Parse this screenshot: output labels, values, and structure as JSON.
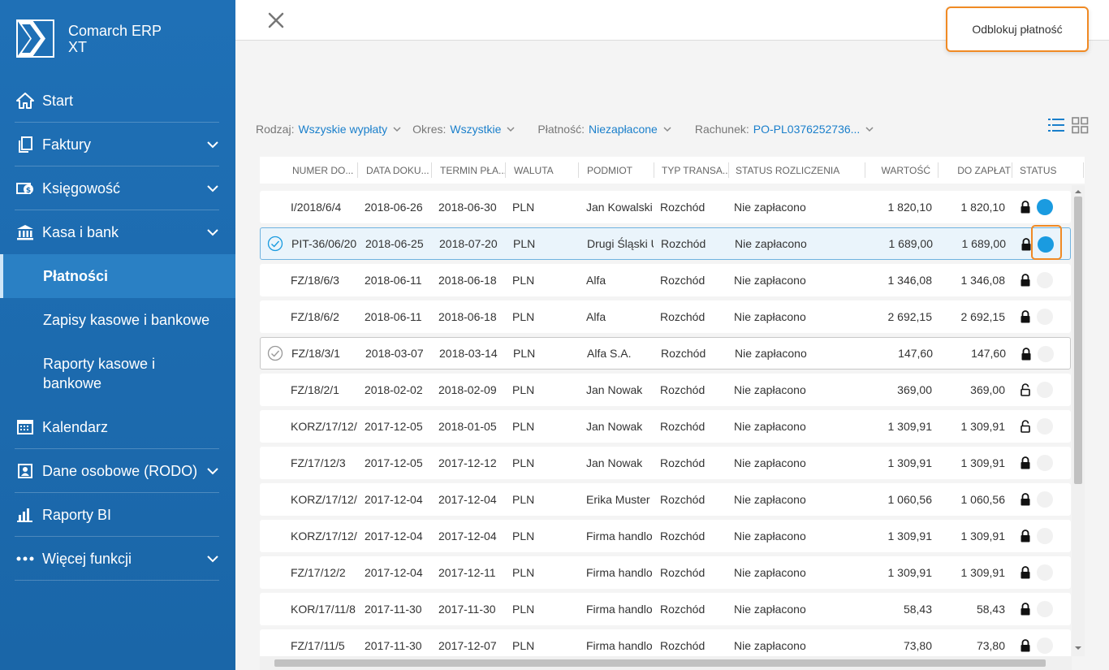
{
  "brand": {
    "line1": "Comarch ERP",
    "line2": "XT"
  },
  "nav": {
    "start": "Start",
    "faktury": "Faktury",
    "ksiegowosc": "Księgowość",
    "kasa": "Kasa i bank",
    "platnosci": "Płatności",
    "zapisy": "Zapisy kasowe i bankowe",
    "raporty_kasowe_1": "Raporty kasowe i",
    "raporty_kasowe_2": "bankowe",
    "kalendarz": "Kalendarz",
    "rodo": "Dane osobowe (RODO)",
    "raporty_bi": "Raporty BI",
    "wiecej": "Więcej funkcji"
  },
  "action_menu": {
    "unlock": "Odblokuj płatność"
  },
  "filters": {
    "rodzaj": {
      "label": "Rodzaj:",
      "value": "Wszyskie wypłaty"
    },
    "okres": {
      "label": "Okres:",
      "value": "Wszystkie"
    },
    "platnosc": {
      "label": "Płatność:",
      "value": "Niezapłacone"
    },
    "rachunek": {
      "label": "Rachunek:",
      "value": "PO-PL0376252736..."
    }
  },
  "columns": [
    "NUMER DO...",
    "DATA DOKU...",
    "TERMIN PŁA...",
    "WALUTA",
    "PODMIOT",
    "TYP TRANSA...",
    "STATUS ROZLICZENIA",
    "WARTOŚĆ",
    "DO ZAPŁAT",
    "STATUS"
  ],
  "rows": [
    {
      "num": "I/2018/6/4",
      "date": "2018-06-26",
      "due": "2018-06-30",
      "cur": "PLN",
      "party": "Jan Kowalski",
      "type": "Rozchód",
      "settle": "Nie zapłacono",
      "value": "1 820,10",
      "topay": "1 820,10",
      "locked": true,
      "dot": true,
      "check": false,
      "state": "normal"
    },
    {
      "num": "PIT-36/06/20",
      "date": "2018-06-25",
      "due": "2018-07-20",
      "cur": "PLN",
      "party": "Drugi Śląski U",
      "type": "Rozchód",
      "settle": "Nie zapłacono",
      "value": "1 689,00",
      "topay": "1 689,00",
      "locked": true,
      "dot": true,
      "check": true,
      "state": "selected"
    },
    {
      "num": "FZ/18/6/3",
      "date": "2018-06-11",
      "due": "2018-06-18",
      "cur": "PLN",
      "party": "Alfa",
      "type": "Rozchód",
      "settle": "Nie zapłacono",
      "value": "1 346,08",
      "topay": "1 346,08",
      "locked": true,
      "dot": false,
      "check": false,
      "state": "normal"
    },
    {
      "num": "FZ/18/6/2",
      "date": "2018-06-11",
      "due": "2018-06-18",
      "cur": "PLN",
      "party": "Alfa",
      "type": "Rozchód",
      "settle": "Nie zapłacono",
      "value": "2 692,15",
      "topay": "2 692,15",
      "locked": true,
      "dot": false,
      "check": false,
      "state": "normal"
    },
    {
      "num": "FZ/18/3/1",
      "date": "2018-03-07",
      "due": "2018-03-14",
      "cur": "PLN",
      "party": "Alfa S.A.",
      "type": "Rozchód",
      "settle": "Nie zapłacono",
      "value": "147,60",
      "topay": "147,60",
      "locked": true,
      "dot": false,
      "check": true,
      "state": "outlined"
    },
    {
      "num": "FZ/18/2/1",
      "date": "2018-02-02",
      "due": "2018-02-09",
      "cur": "PLN",
      "party": "Jan Nowak",
      "type": "Rozchód",
      "settle": "Nie zapłacono",
      "value": "369,00",
      "topay": "369,00",
      "locked": false,
      "dot": false,
      "check": false,
      "state": "normal"
    },
    {
      "num": "KORZ/17/12/",
      "date": "2017-12-05",
      "due": "2018-01-05",
      "cur": "PLN",
      "party": "Jan Nowak",
      "type": "Rozchód",
      "settle": "Nie zapłacono",
      "value": "1 309,91",
      "topay": "1 309,91",
      "locked": false,
      "dot": false,
      "check": false,
      "state": "normal"
    },
    {
      "num": "FZ/17/12/3",
      "date": "2017-12-05",
      "due": "2017-12-12",
      "cur": "PLN",
      "party": "Jan Nowak",
      "type": "Rozchód",
      "settle": "Nie zapłacono",
      "value": "1 309,91",
      "topay": "1 309,91",
      "locked": true,
      "dot": false,
      "check": false,
      "state": "normal"
    },
    {
      "num": "KORZ/17/12/",
      "date": "2017-12-04",
      "due": "2017-12-04",
      "cur": "PLN",
      "party": "Erika Muster",
      "type": "Rozchód",
      "settle": "Nie zapłacono",
      "value": "1 060,56",
      "topay": "1 060,56",
      "locked": true,
      "dot": false,
      "check": false,
      "state": "normal"
    },
    {
      "num": "KORZ/17/12/",
      "date": "2017-12-04",
      "due": "2017-12-04",
      "cur": "PLN",
      "party": "Firma handlo",
      "type": "Rozchód",
      "settle": "Nie zapłacono",
      "value": "1 309,91",
      "topay": "1 309,91",
      "locked": true,
      "dot": false,
      "check": false,
      "state": "normal"
    },
    {
      "num": "FZ/17/12/2",
      "date": "2017-12-04",
      "due": "2017-12-11",
      "cur": "PLN",
      "party": "Firma handlo",
      "type": "Rozchód",
      "settle": "Nie zapłacono",
      "value": "1 309,91",
      "topay": "1 309,91",
      "locked": true,
      "dot": false,
      "check": false,
      "state": "normal"
    },
    {
      "num": "KOR/17/11/8",
      "date": "2017-11-30",
      "due": "2017-11-30",
      "cur": "PLN",
      "party": "Firma handlo",
      "type": "Rozchód",
      "settle": "Nie zapłacono",
      "value": "58,43",
      "topay": "58,43",
      "locked": true,
      "dot": false,
      "check": false,
      "state": "normal"
    },
    {
      "num": "FZ/17/11/5",
      "date": "2017-11-30",
      "due": "2017-12-07",
      "cur": "PLN",
      "party": "Firma handlo",
      "type": "Rozchód",
      "settle": "Nie zapłacono",
      "value": "73,80",
      "topay": "73,80",
      "locked": true,
      "dot": false,
      "check": false,
      "state": "normal"
    }
  ],
  "colors": {
    "sidebar": "#1f70b6",
    "accent": "#1a7fcb",
    "highlight": "#f08a24",
    "status_on": "#1a9be0"
  }
}
